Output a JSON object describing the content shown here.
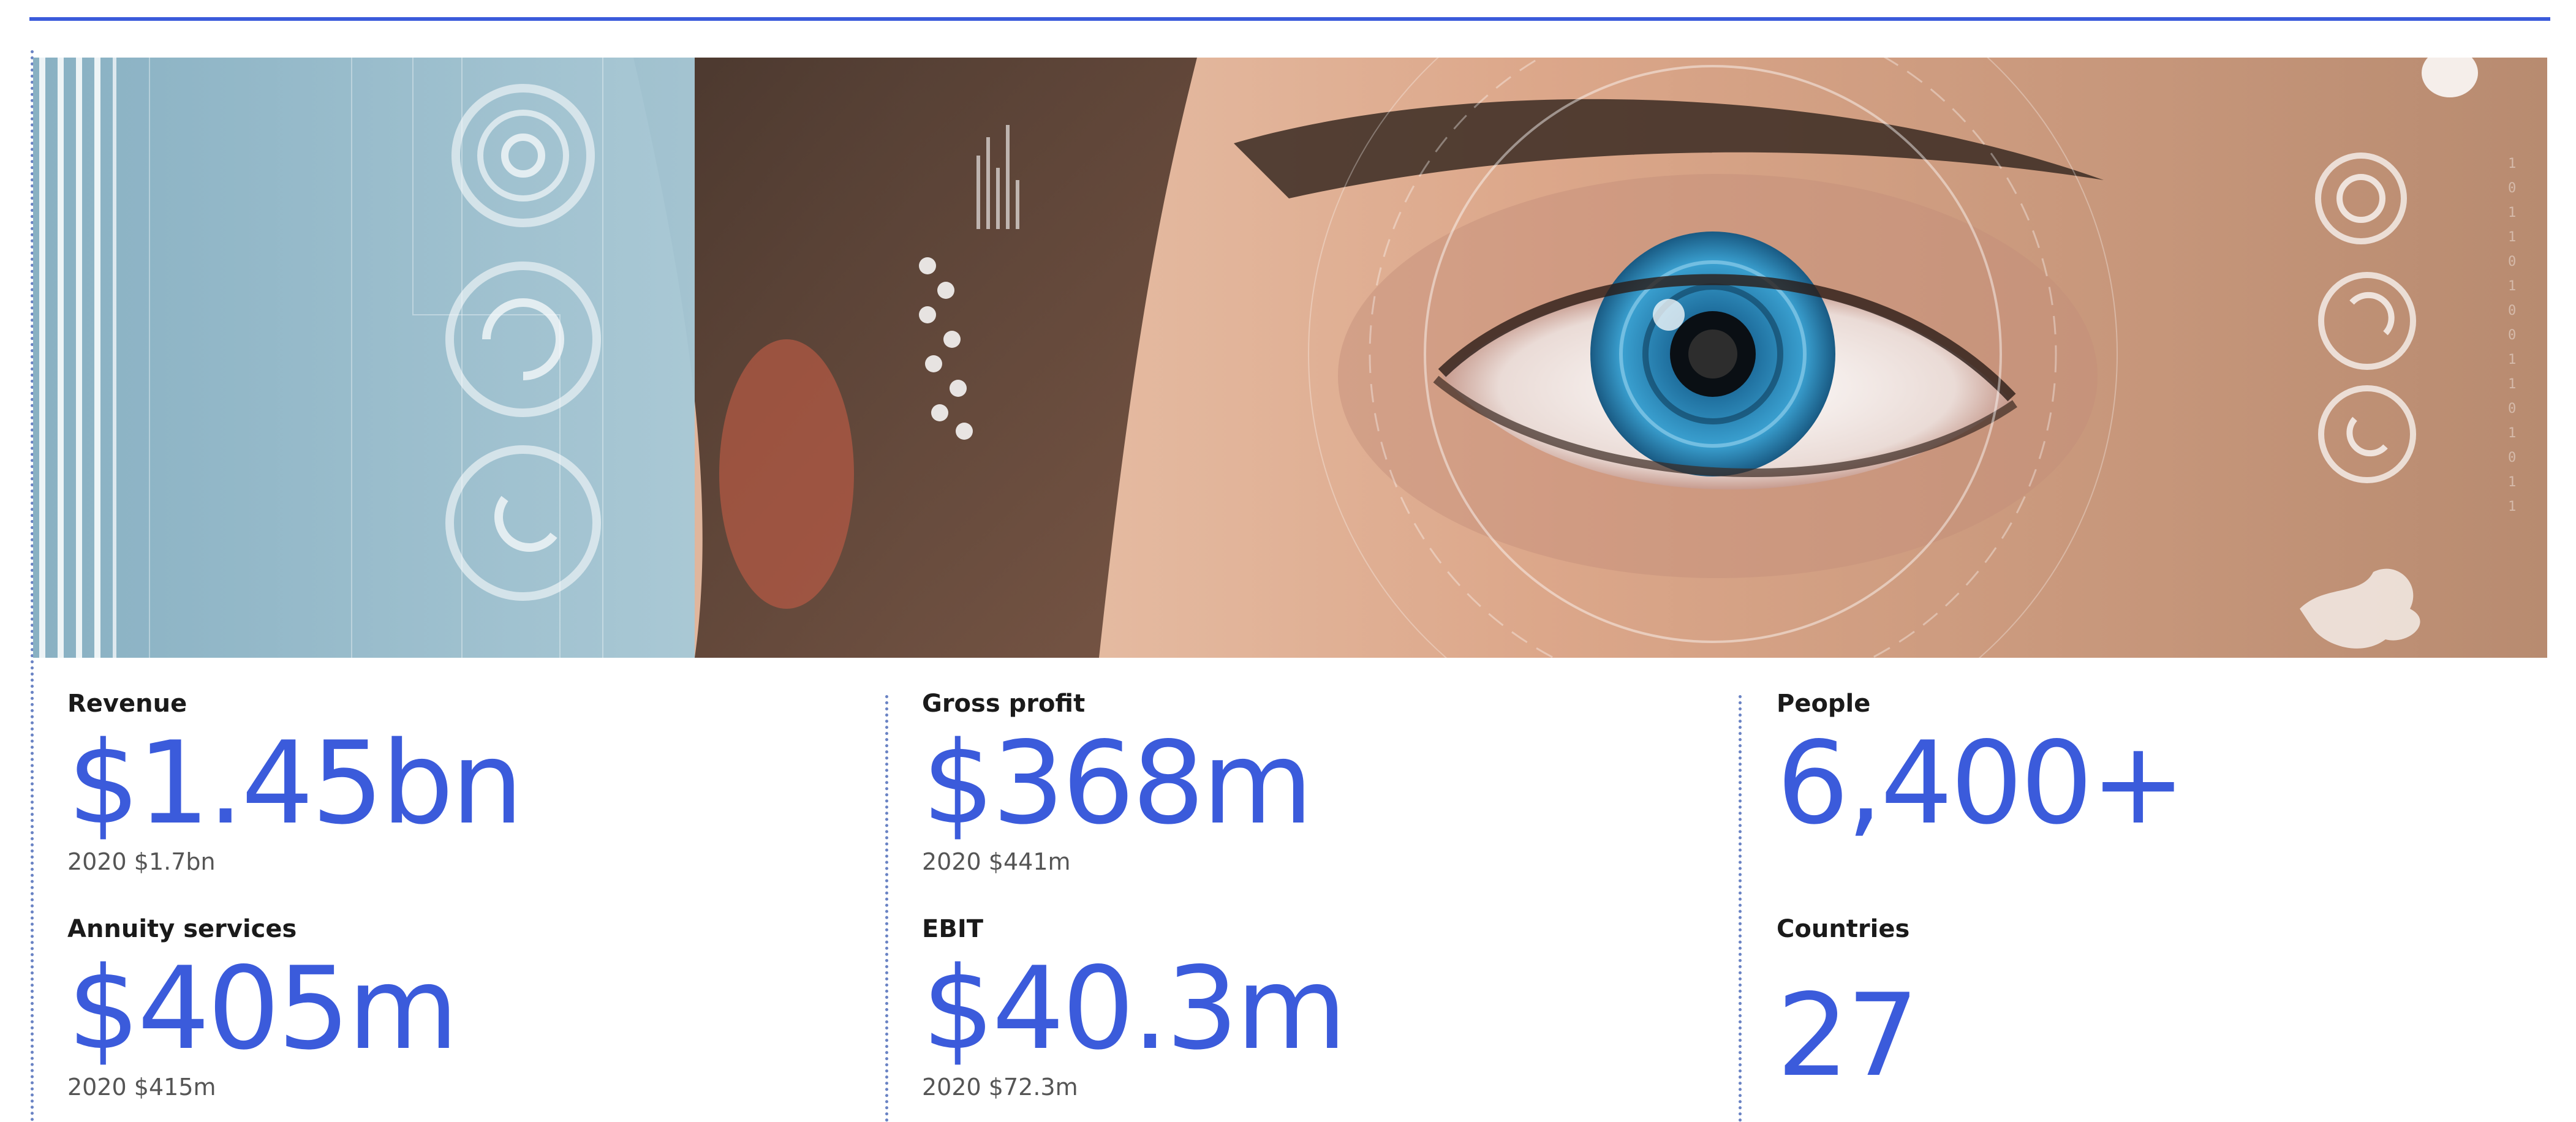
{
  "stats": {
    "revenue": {
      "label": "Revenue",
      "value": "$1.45bn",
      "prior": "2020 $1.7bn"
    },
    "gross_profit": {
      "label": "Gross profit",
      "value": "$368m",
      "prior": "2020 $441m"
    },
    "people": {
      "label": "People",
      "value": "6,400+"
    },
    "annuity_services": {
      "label": "Annuity services",
      "value": "$405m",
      "prior": "2020 $415m"
    },
    "ebit": {
      "label": "EBIT",
      "value": "$40.3m",
      "prior": "2020 $72.3m"
    },
    "countries": {
      "label": "Countries",
      "value": "27"
    }
  },
  "colors": {
    "accent": "#3b5bdb",
    "divider": "#6a83c4",
    "label_text": "#1a1a1a",
    "prior_text": "#555555",
    "hero_panel_blue": "#8fb7c9",
    "iris": "#2f89b9"
  },
  "icons": [
    "hud-ring-icon",
    "hud-ring-icon",
    "hud-ring-icon",
    "world-map-icon"
  ]
}
